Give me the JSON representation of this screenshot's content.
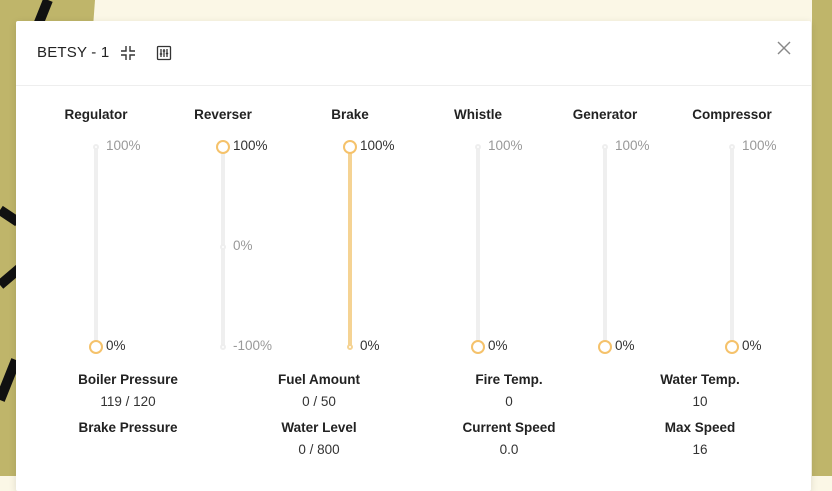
{
  "panel": {
    "title": "BETSY - 1",
    "icons": {
      "collapse": "collapse-icon",
      "settings": "sliders-icon",
      "close": "close-icon"
    }
  },
  "colors": {
    "accent": "#f5c26b",
    "accent_fill": "#f5d393",
    "rail": "#efefef",
    "background": "#fbf7e6",
    "art_olive": "#bfb56a"
  },
  "controls": [
    {
      "label": "Regulator",
      "marks": [
        "100%",
        "0%"
      ],
      "value": "0%",
      "level": 0
    },
    {
      "label": "Reverser",
      "marks": [
        "100%",
        "0%",
        "-100%"
      ],
      "value": "100%",
      "level": 1
    },
    {
      "label": "Brake",
      "marks": [
        "100%",
        "0%"
      ],
      "value": "100%",
      "level": 1
    },
    {
      "label": "Whistle",
      "marks": [
        "100%",
        "0%"
      ],
      "value": "0%",
      "level": 0
    },
    {
      "label": "Generator",
      "marks": [
        "100%",
        "0%"
      ],
      "value": "0%",
      "level": 0
    },
    {
      "label": "Compressor",
      "marks": [
        "100%",
        "0%"
      ],
      "value": "0%",
      "level": 0
    }
  ],
  "stats": [
    {
      "label": "Boiler Pressure",
      "value": "119 / 120"
    },
    {
      "label": "Fuel Amount",
      "value": "0 / 50"
    },
    {
      "label": "Fire Temp.",
      "value": "0"
    },
    {
      "label": "Water Temp.",
      "value": "10"
    },
    {
      "label": "Brake Pressure",
      "value": ""
    },
    {
      "label": "Water Level",
      "value": "0 / 800"
    },
    {
      "label": "Current Speed",
      "value": "0.0"
    },
    {
      "label": "Max Speed",
      "value": "16"
    }
  ]
}
